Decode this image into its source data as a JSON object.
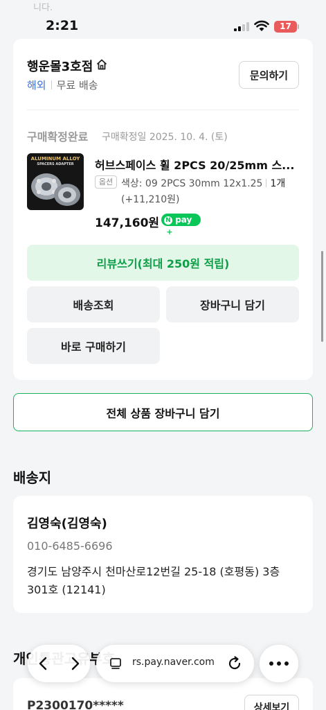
{
  "top_fragment": "니다.",
  "status_bar": {
    "time": "2:21",
    "battery": "17"
  },
  "store": {
    "name": "행운몰3호점",
    "tag_overseas": "해외",
    "tag_shipping": "무료 배송",
    "inquiry_label": "문의하기"
  },
  "order": {
    "status": "구매확정완료",
    "date_text": "구매확정일 2025. 10. 4. (토)",
    "product_name": "허브스페이스 휠 2PCS 20/25mm 스...",
    "thumb_line1": "ALUMINUM ALLOY",
    "thumb_line2": "SPACERS ADAPTER",
    "option_badge": "옵션",
    "option_value": "색상: 09 2PCS 30mm 12x1.25",
    "option_qty": "1개",
    "option_extra": "(+11,210원)",
    "price": "147,160원",
    "npay_label": "pay"
  },
  "actions": {
    "review": "리뷰쓰기(최대 250원 적립)",
    "track": "배송조회",
    "cart": "장바구니 담기",
    "buy_now": "바로 구매하기",
    "cart_all": "전체 상품 장바구니 담기"
  },
  "delivery": {
    "section_title": "배송지",
    "recipient": "김영숙(김영숙)",
    "phone": "010-6485-6696",
    "address": "경기도 남양주시 천마산로12번길 25-18 (호평동) 3층 301호 (12141)"
  },
  "customs": {
    "section_title": "개인통관고유부호",
    "code": "P2300170*****",
    "detail_label": "상세보기"
  },
  "browser": {
    "url": "rs.pay.naver.com"
  },
  "colors": {
    "accent_green": "#0c9f47",
    "review_bg": "#e3f7e8",
    "npay_green": "#08c758",
    "overseas_blue": "#3b6fd8",
    "battery_red": "#e95b5b"
  },
  "icons": [
    "home-icon",
    "back-arrow-icon",
    "forward-arrow-icon",
    "tabs-icon",
    "reload-icon",
    "more-icon",
    "wifi-icon",
    "signal-icon",
    "battery-icon"
  ]
}
